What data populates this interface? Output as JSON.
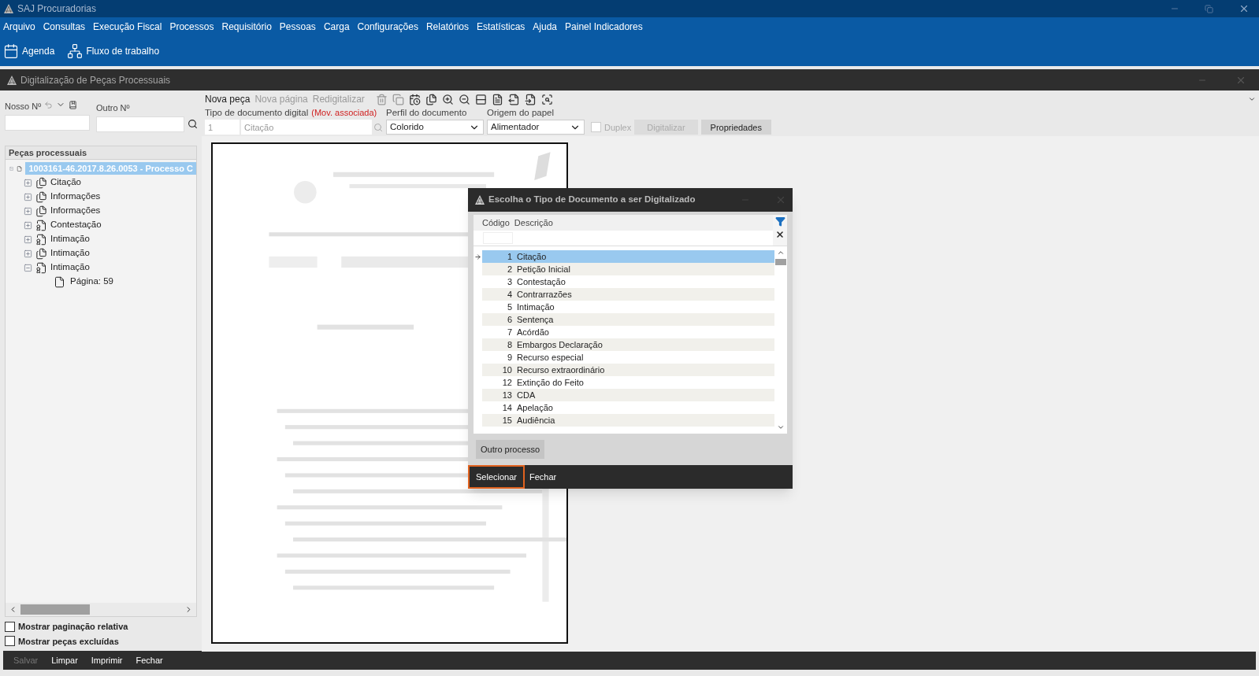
{
  "app": {
    "title": "SAJ Procuradorias"
  },
  "menu": [
    "Arquivo",
    "Consultas",
    "Execução Fiscal",
    "Processos",
    "Requisitório",
    "Pessoas",
    "Carga",
    "Configurações",
    "Relatórios",
    "Estatísticas",
    "Ajuda",
    "Painel Indicadores"
  ],
  "toolbar": [
    {
      "label": "Agenda",
      "kind": "calendar"
    },
    {
      "label": "Fluxo de trabalho",
      "kind": "flow"
    }
  ],
  "window": {
    "title": "Digitalização de Peças Processuais"
  },
  "search": {
    "nosso_label": "Nosso Nº",
    "outro_label": "Outro Nº"
  },
  "tree": {
    "title": "Peças processuais",
    "root": {
      "label": "1003161-46.2017.8.26.0053 - Processo C",
      "selected": true,
      "expanded": true,
      "children": [
        {
          "label": "Citação",
          "kind": "doc",
          "expanded": false
        },
        {
          "label": "Informações",
          "kind": "doc",
          "expanded": false
        },
        {
          "label": "Informações",
          "kind": "doc",
          "expanded": false
        },
        {
          "label": "Contestação",
          "kind": "seal",
          "expanded": false
        },
        {
          "label": "Intimação",
          "kind": "seal",
          "expanded": false
        },
        {
          "label": "Intimação",
          "kind": "doc",
          "expanded": false
        },
        {
          "label": "Intimação",
          "kind": "seal",
          "expanded": true,
          "children": [
            {
              "label": "Página: 59",
              "kind": "page"
            }
          ]
        }
      ]
    }
  },
  "options": [
    {
      "label": "Mostrar paginação relativa",
      "checked": false
    },
    {
      "label": "Mostrar peças excluídas",
      "checked": false
    }
  ],
  "bottom_actions": [
    {
      "label": "Salvar",
      "disabled": true
    },
    {
      "label": "Limpar",
      "disabled": false
    },
    {
      "label": "Imprimir",
      "disabled": false
    },
    {
      "label": "Fechar",
      "disabled": false
    }
  ],
  "page_actions": [
    {
      "label": "Nova peça",
      "disabled": false
    },
    {
      "label": "Nova página",
      "disabled": true
    },
    {
      "label": "Redigitalizar",
      "disabled": true
    }
  ],
  "form": {
    "tipo": {
      "label": "Tipo de documento digital",
      "note": "(Mov. associada)",
      "code": "1",
      "placeholder": "Citação"
    },
    "perfil": {
      "label": "Perfil do documento",
      "value": "Colorido"
    },
    "origem": {
      "label": "Origem do papel",
      "value": "Alimentador"
    },
    "duplex": {
      "label": "Duplex",
      "checked": false,
      "disabled": true
    },
    "buttons": [
      {
        "label": "Digitalizar",
        "disabled": true
      },
      {
        "label": "Propriedades",
        "disabled": false
      }
    ]
  },
  "dialog": {
    "title": "Escolha o Tipo de Documento a ser Digitalizado",
    "columns": [
      "Código",
      "Descrição"
    ],
    "rows": [
      {
        "code": "1",
        "description": "Citação",
        "selected": true
      },
      {
        "code": "2",
        "description": "Petição Inicial",
        "selected": false
      },
      {
        "code": "3",
        "description": "Contestação",
        "selected": false
      },
      {
        "code": "4",
        "description": "Contrarrazões",
        "selected": false
      },
      {
        "code": "5",
        "description": "Intimação",
        "selected": false
      },
      {
        "code": "6",
        "description": "Sentença",
        "selected": false
      },
      {
        "code": "7",
        "description": "Acórdão",
        "selected": false
      },
      {
        "code": "8",
        "description": "Embargos Declaração",
        "selected": false
      },
      {
        "code": "9",
        "description": "Recurso especial",
        "selected": false
      },
      {
        "code": "10",
        "description": "Recurso extraordinário",
        "selected": false
      },
      {
        "code": "12",
        "description": "Extinção do Feito",
        "selected": false
      },
      {
        "code": "13",
        "description": "CDA",
        "selected": false
      },
      {
        "code": "14",
        "description": "Apelação",
        "selected": false
      },
      {
        "code": "15",
        "description": "Audiência",
        "selected": false
      }
    ],
    "other_button": "Outro processo",
    "actions": [
      {
        "label": "Selecionar",
        "focused": true
      },
      {
        "label": "Fechar",
        "focused": false
      }
    ]
  }
}
